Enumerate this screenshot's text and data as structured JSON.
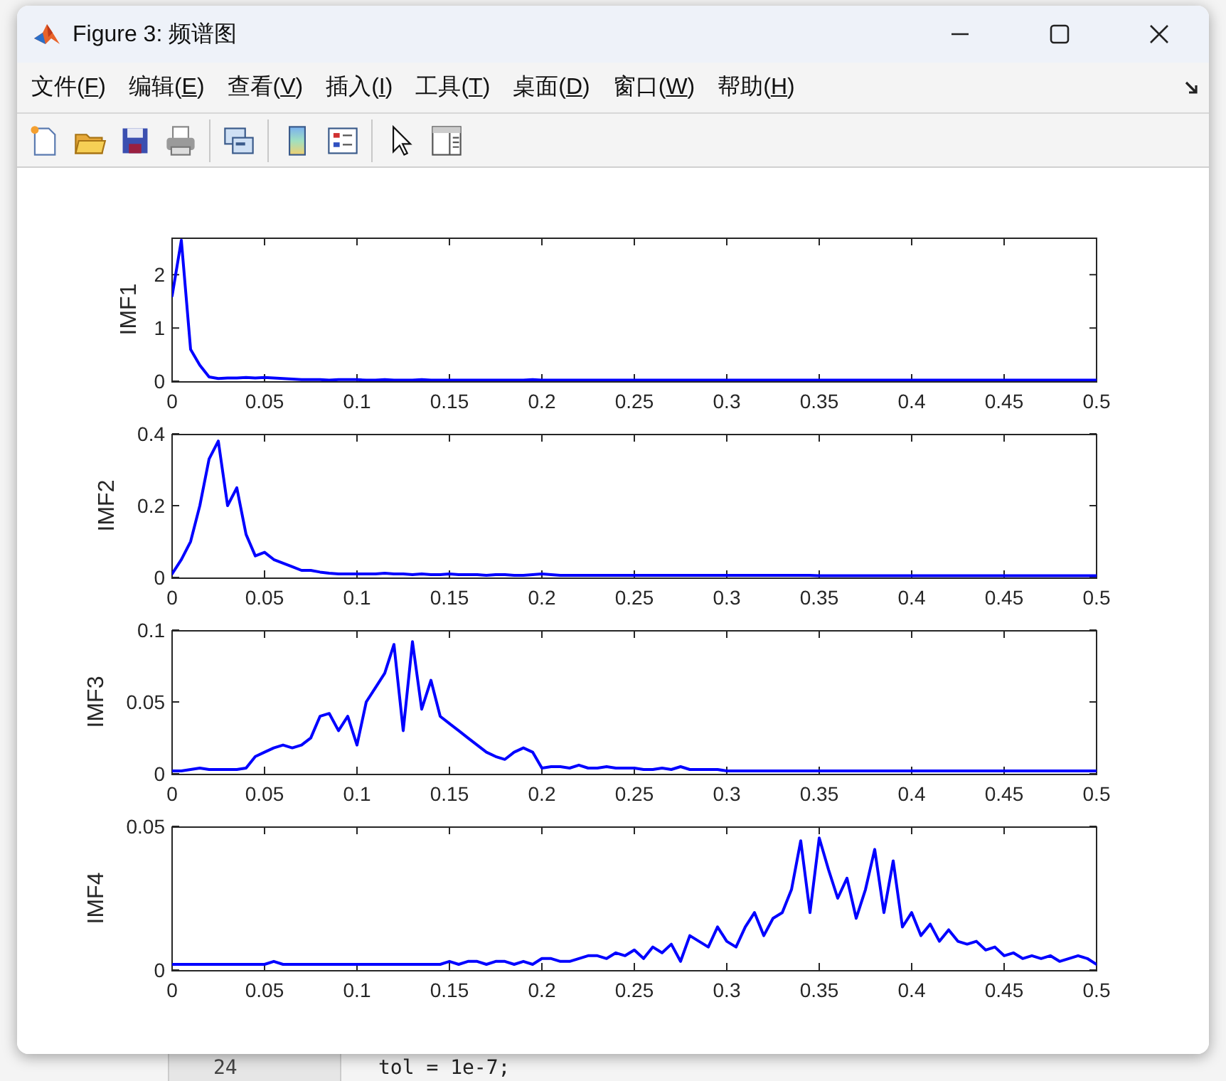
{
  "background_window": {
    "line_number": "24",
    "code_line": "tol = 1e-7;"
  },
  "window": {
    "title": "Figure 3: 频谱图"
  },
  "menu": [
    "文件(F)",
    "编辑(E)",
    "查看(V)",
    "插入(I)",
    "工具(T)",
    "桌面(D)",
    "窗口(W)",
    "帮助(H)"
  ],
  "plots": [
    {
      "chart_data": {
        "type": "line",
        "ylabel": "IMF1",
        "xlim": [
          0,
          0.5
        ],
        "ylim": [
          0,
          2.7
        ],
        "xticks": [
          0,
          0.05,
          0.1,
          0.15,
          0.2,
          0.25,
          0.3,
          0.35,
          0.4,
          0.45,
          0.5
        ],
        "yticks": [
          0,
          1,
          2
        ],
        "x": [
          0,
          0.005,
          0.01,
          0.015,
          0.02,
          0.025,
          0.03,
          0.035,
          0.04,
          0.045,
          0.05,
          0.055,
          0.06,
          0.065,
          0.07,
          0.075,
          0.08,
          0.085,
          0.09,
          0.095,
          0.1,
          0.105,
          0.11,
          0.115,
          0.12,
          0.125,
          0.13,
          0.135,
          0.14,
          0.145,
          0.15,
          0.155,
          0.16,
          0.165,
          0.17,
          0.175,
          0.18,
          0.185,
          0.19,
          0.195,
          0.2,
          0.205,
          0.21,
          0.215,
          0.22,
          0.225,
          0.23,
          0.235,
          0.24,
          0.245,
          0.25,
          0.255,
          0.26,
          0.265,
          0.27,
          0.275,
          0.28,
          0.285,
          0.29,
          0.295,
          0.3,
          0.305,
          0.31,
          0.315,
          0.32,
          0.325,
          0.33,
          0.335,
          0.34,
          0.345,
          0.35,
          0.355,
          0.36,
          0.365,
          0.37,
          0.375,
          0.38,
          0.385,
          0.39,
          0.395,
          0.4,
          0.405,
          0.41,
          0.415,
          0.42,
          0.425,
          0.43,
          0.435,
          0.44,
          0.445,
          0.45,
          0.455,
          0.46,
          0.465,
          0.47,
          0.475,
          0.48,
          0.485,
          0.49,
          0.495,
          0.5
        ],
        "series": [
          {
            "color": "#0000ff",
            "values": [
              1.6,
              2.65,
              0.6,
              0.3,
              0.08,
              0.05,
              0.06,
              0.06,
              0.07,
              0.06,
              0.07,
              0.06,
              0.05,
              0.04,
              0.03,
              0.03,
              0.03,
              0.02,
              0.03,
              0.03,
              0.03,
              0.02,
              0.02,
              0.03,
              0.02,
              0.02,
              0.02,
              0.03,
              0.02,
              0.02,
              0.02,
              0.02,
              0.02,
              0.02,
              0.02,
              0.02,
              0.02,
              0.02,
              0.02,
              0.03,
              0.02,
              0.02,
              0.02,
              0.02,
              0.02,
              0.02,
              0.02,
              0.02,
              0.02,
              0.02,
              0.02,
              0.02,
              0.02,
              0.02,
              0.02,
              0.02,
              0.02,
              0.02,
              0.02,
              0.02,
              0.02,
              0.02,
              0.02,
              0.02,
              0.02,
              0.02,
              0.02,
              0.02,
              0.02,
              0.02,
              0.02,
              0.02,
              0.02,
              0.02,
              0.02,
              0.02,
              0.02,
              0.02,
              0.02,
              0.02,
              0.02,
              0.02,
              0.02,
              0.02,
              0.02,
              0.02,
              0.02,
              0.02,
              0.02,
              0.02,
              0.02,
              0.02,
              0.02,
              0.02,
              0.02,
              0.02,
              0.02,
              0.02,
              0.02,
              0.02,
              0.02
            ]
          }
        ]
      }
    },
    {
      "chart_data": {
        "type": "line",
        "ylabel": "IMF2",
        "xlim": [
          0,
          0.5
        ],
        "ylim": [
          0,
          0.4
        ],
        "xticks": [
          0,
          0.05,
          0.1,
          0.15,
          0.2,
          0.25,
          0.3,
          0.35,
          0.4,
          0.45,
          0.5
        ],
        "yticks": [
          0,
          0.2,
          0.4
        ],
        "x": [
          0,
          0.005,
          0.01,
          0.015,
          0.02,
          0.025,
          0.03,
          0.035,
          0.04,
          0.045,
          0.05,
          0.055,
          0.06,
          0.065,
          0.07,
          0.075,
          0.08,
          0.085,
          0.09,
          0.095,
          0.1,
          0.105,
          0.11,
          0.115,
          0.12,
          0.125,
          0.13,
          0.135,
          0.14,
          0.145,
          0.15,
          0.155,
          0.16,
          0.165,
          0.17,
          0.175,
          0.18,
          0.185,
          0.19,
          0.195,
          0.2,
          0.205,
          0.21,
          0.215,
          0.22,
          0.225,
          0.23,
          0.235,
          0.24,
          0.245,
          0.25,
          0.255,
          0.26,
          0.265,
          0.27,
          0.275,
          0.28,
          0.285,
          0.29,
          0.295,
          0.3,
          0.305,
          0.31,
          0.315,
          0.32,
          0.325,
          0.33,
          0.335,
          0.34,
          0.345,
          0.35,
          0.355,
          0.36,
          0.365,
          0.37,
          0.375,
          0.38,
          0.385,
          0.39,
          0.395,
          0.4,
          0.405,
          0.41,
          0.415,
          0.42,
          0.425,
          0.43,
          0.435,
          0.44,
          0.445,
          0.45,
          0.455,
          0.46,
          0.465,
          0.47,
          0.475,
          0.48,
          0.485,
          0.49,
          0.495,
          0.5
        ],
        "series": [
          {
            "color": "#0000ff",
            "values": [
              0.01,
              0.05,
              0.1,
              0.2,
              0.33,
              0.38,
              0.2,
              0.25,
              0.12,
              0.06,
              0.07,
              0.05,
              0.04,
              0.03,
              0.02,
              0.02,
              0.015,
              0.012,
              0.01,
              0.01,
              0.01,
              0.01,
              0.01,
              0.012,
              0.01,
              0.01,
              0.008,
              0.01,
              0.008,
              0.008,
              0.01,
              0.008,
              0.008,
              0.008,
              0.006,
              0.008,
              0.008,
              0.006,
              0.006,
              0.008,
              0.01,
              0.008,
              0.006,
              0.006,
              0.006,
              0.006,
              0.006,
              0.006,
              0.006,
              0.006,
              0.006,
              0.006,
              0.006,
              0.006,
              0.006,
              0.006,
              0.006,
              0.006,
              0.006,
              0.006,
              0.006,
              0.006,
              0.006,
              0.006,
              0.006,
              0.006,
              0.006,
              0.006,
              0.006,
              0.006,
              0.005,
              0.005,
              0.005,
              0.005,
              0.005,
              0.005,
              0.005,
              0.005,
              0.005,
              0.005,
              0.005,
              0.005,
              0.005,
              0.005,
              0.005,
              0.005,
              0.005,
              0.005,
              0.005,
              0.005,
              0.005,
              0.005,
              0.005,
              0.005,
              0.005,
              0.005,
              0.005,
              0.005,
              0.005,
              0.005,
              0.005
            ]
          }
        ]
      }
    },
    {
      "chart_data": {
        "type": "line",
        "ylabel": "IMF3",
        "xlim": [
          0,
          0.5
        ],
        "ylim": [
          0,
          0.1
        ],
        "xticks": [
          0,
          0.05,
          0.1,
          0.15,
          0.2,
          0.25,
          0.3,
          0.35,
          0.4,
          0.45,
          0.5
        ],
        "yticks": [
          0,
          0.05,
          0.1
        ],
        "x": [
          0,
          0.005,
          0.01,
          0.015,
          0.02,
          0.025,
          0.03,
          0.035,
          0.04,
          0.045,
          0.05,
          0.055,
          0.06,
          0.065,
          0.07,
          0.075,
          0.08,
          0.085,
          0.09,
          0.095,
          0.1,
          0.105,
          0.11,
          0.115,
          0.12,
          0.125,
          0.13,
          0.135,
          0.14,
          0.145,
          0.15,
          0.155,
          0.16,
          0.165,
          0.17,
          0.175,
          0.18,
          0.185,
          0.19,
          0.195,
          0.2,
          0.205,
          0.21,
          0.215,
          0.22,
          0.225,
          0.23,
          0.235,
          0.24,
          0.245,
          0.25,
          0.255,
          0.26,
          0.265,
          0.27,
          0.275,
          0.28,
          0.285,
          0.29,
          0.295,
          0.3,
          0.305,
          0.31,
          0.315,
          0.32,
          0.325,
          0.33,
          0.335,
          0.34,
          0.345,
          0.35,
          0.355,
          0.36,
          0.365,
          0.37,
          0.375,
          0.38,
          0.385,
          0.39,
          0.395,
          0.4,
          0.405,
          0.41,
          0.415,
          0.42,
          0.425,
          0.43,
          0.435,
          0.44,
          0.445,
          0.45,
          0.455,
          0.46,
          0.465,
          0.47,
          0.475,
          0.48,
          0.485,
          0.49,
          0.495,
          0.5
        ],
        "series": [
          {
            "color": "#0000ff",
            "values": [
              0.002,
              0.002,
              0.003,
              0.004,
              0.003,
              0.003,
              0.003,
              0.003,
              0.004,
              0.012,
              0.015,
              0.018,
              0.02,
              0.018,
              0.02,
              0.025,
              0.04,
              0.042,
              0.03,
              0.04,
              0.02,
              0.05,
              0.06,
              0.07,
              0.09,
              0.03,
              0.092,
              0.045,
              0.065,
              0.04,
              0.035,
              0.03,
              0.025,
              0.02,
              0.015,
              0.012,
              0.01,
              0.015,
              0.018,
              0.015,
              0.004,
              0.005,
              0.005,
              0.004,
              0.006,
              0.004,
              0.004,
              0.005,
              0.004,
              0.004,
              0.004,
              0.003,
              0.003,
              0.004,
              0.003,
              0.005,
              0.003,
              0.003,
              0.003,
              0.003,
              0.002,
              0.002,
              0.002,
              0.002,
              0.002,
              0.002,
              0.002,
              0.002,
              0.002,
              0.002,
              0.002,
              0.002,
              0.002,
              0.002,
              0.002,
              0.002,
              0.002,
              0.002,
              0.002,
              0.002,
              0.002,
              0.002,
              0.002,
              0.002,
              0.002,
              0.002,
              0.002,
              0.002,
              0.002,
              0.002,
              0.002,
              0.002,
              0.002,
              0.002,
              0.002,
              0.002,
              0.002,
              0.002,
              0.002,
              0.002,
              0.002
            ]
          }
        ]
      }
    },
    {
      "chart_data": {
        "type": "line",
        "ylabel": "IMF4",
        "xlim": [
          0,
          0.5
        ],
        "ylim": [
          0,
          0.05
        ],
        "xticks": [
          0,
          0.05,
          0.1,
          0.15,
          0.2,
          0.25,
          0.3,
          0.35,
          0.4,
          0.45,
          0.5
        ],
        "yticks": [
          0,
          0.05
        ],
        "x": [
          0,
          0.005,
          0.01,
          0.015,
          0.02,
          0.025,
          0.03,
          0.035,
          0.04,
          0.045,
          0.05,
          0.055,
          0.06,
          0.065,
          0.07,
          0.075,
          0.08,
          0.085,
          0.09,
          0.095,
          0.1,
          0.105,
          0.11,
          0.115,
          0.12,
          0.125,
          0.13,
          0.135,
          0.14,
          0.145,
          0.15,
          0.155,
          0.16,
          0.165,
          0.17,
          0.175,
          0.18,
          0.185,
          0.19,
          0.195,
          0.2,
          0.205,
          0.21,
          0.215,
          0.22,
          0.225,
          0.23,
          0.235,
          0.24,
          0.245,
          0.25,
          0.255,
          0.26,
          0.265,
          0.27,
          0.275,
          0.28,
          0.285,
          0.29,
          0.295,
          0.3,
          0.305,
          0.31,
          0.315,
          0.32,
          0.325,
          0.33,
          0.335,
          0.34,
          0.345,
          0.35,
          0.355,
          0.36,
          0.365,
          0.37,
          0.375,
          0.38,
          0.385,
          0.39,
          0.395,
          0.4,
          0.405,
          0.41,
          0.415,
          0.42,
          0.425,
          0.43,
          0.435,
          0.44,
          0.445,
          0.45,
          0.455,
          0.46,
          0.465,
          0.47,
          0.475,
          0.48,
          0.485,
          0.49,
          0.495,
          0.5
        ],
        "series": [
          {
            "color": "#0000ff",
            "values": [
              0.002,
              0.002,
              0.002,
              0.002,
              0.002,
              0.002,
              0.002,
              0.002,
              0.002,
              0.002,
              0.002,
              0.003,
              0.002,
              0.002,
              0.002,
              0.002,
              0.002,
              0.002,
              0.002,
              0.002,
              0.002,
              0.002,
              0.002,
              0.002,
              0.002,
              0.002,
              0.002,
              0.002,
              0.002,
              0.002,
              0.003,
              0.002,
              0.003,
              0.003,
              0.002,
              0.003,
              0.003,
              0.002,
              0.003,
              0.002,
              0.004,
              0.004,
              0.003,
              0.003,
              0.004,
              0.005,
              0.005,
              0.004,
              0.006,
              0.005,
              0.007,
              0.004,
              0.008,
              0.006,
              0.009,
              0.003,
              0.012,
              0.01,
              0.008,
              0.015,
              0.01,
              0.008,
              0.015,
              0.02,
              0.012,
              0.018,
              0.02,
              0.028,
              0.045,
              0.02,
              0.046,
              0.035,
              0.025,
              0.032,
              0.018,
              0.028,
              0.042,
              0.02,
              0.038,
              0.015,
              0.02,
              0.012,
              0.016,
              0.01,
              0.014,
              0.01,
              0.009,
              0.01,
              0.007,
              0.008,
              0.005,
              0.006,
              0.004,
              0.005,
              0.004,
              0.005,
              0.003,
              0.004,
              0.005,
              0.004,
              0.002
            ]
          }
        ]
      }
    }
  ]
}
